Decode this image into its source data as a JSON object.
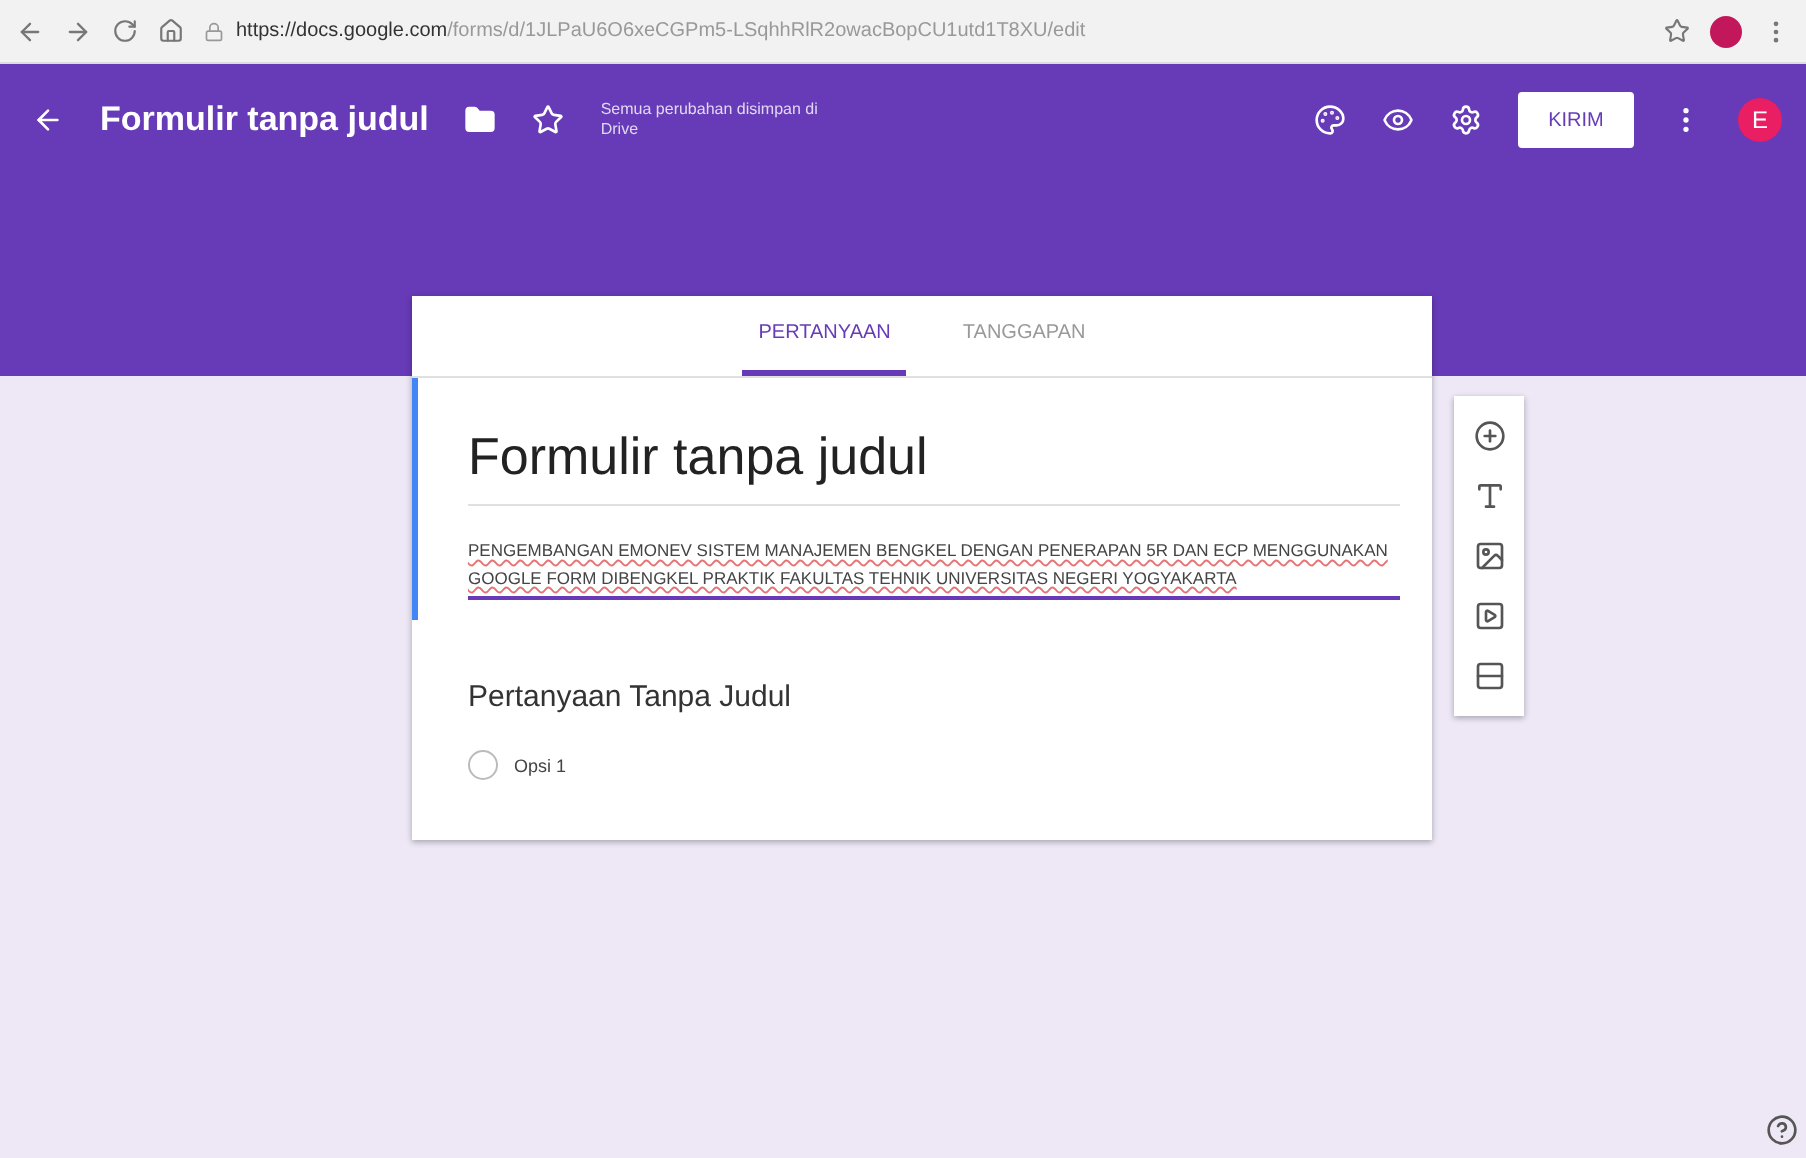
{
  "browser": {
    "url_domain": "https://docs.google.com",
    "url_path": "/forms/d/1JLPaU6O6xeCGPm5-LSqhhRlR2owacBopCU1utd1T8XU/edit"
  },
  "header": {
    "title": "Formulir tanpa judul",
    "save_status": "Semua perubahan disimpan di Drive",
    "send_button": "KIRIM",
    "avatar": "E"
  },
  "tabs": [
    {
      "label": "PERTANYAAN",
      "selected": true
    },
    {
      "label": "TANGGAPAN",
      "selected": false
    }
  ],
  "form": {
    "title": "Formulir tanpa judul",
    "description": "PENGEMBANGAN EMONEV SISTEM MANAJEMEN BENGKEL DENGAN PENERAPAN 5R DAN ECP MENGGUNAKAN GOOGLE FORM DIBENGKEL PRAKTIK FAKULTAS TEHNIK UNIVERSITAS NEGERI YOGYAKARTA"
  },
  "question": {
    "title": "Pertanyaan Tanpa Judul",
    "options": [
      {
        "label": "Opsi 1",
        "selected": false
      }
    ]
  }
}
